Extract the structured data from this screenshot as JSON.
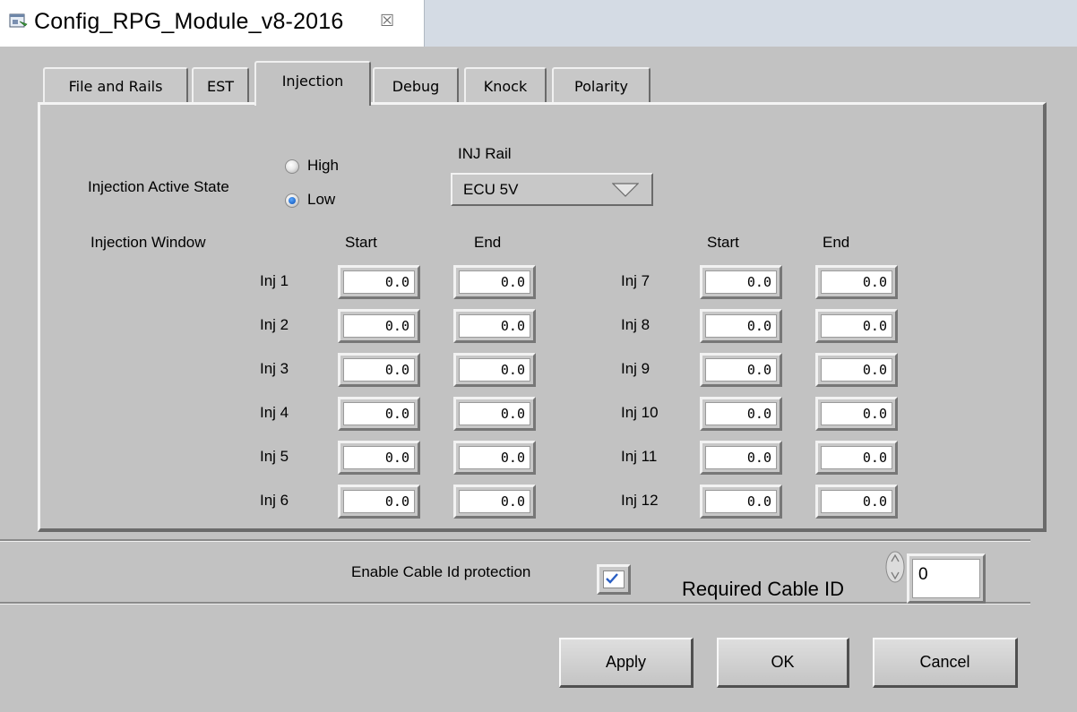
{
  "window": {
    "title": "Config_RPG_Module_v8-2016",
    "close_glyph": "☒",
    "icon": "vi-document-icon"
  },
  "tabs": [
    {
      "label": "File and Rails",
      "active": false
    },
    {
      "label": "EST",
      "active": false
    },
    {
      "label": "Injection",
      "active": true
    },
    {
      "label": "Debug",
      "active": false
    },
    {
      "label": "Knock",
      "active": false
    },
    {
      "label": "Polarity",
      "active": false
    }
  ],
  "injection": {
    "active_state_label": "Injection  Active State",
    "options": [
      {
        "label": "High",
        "selected": false
      },
      {
        "label": "Low",
        "selected": true
      }
    ],
    "rail_label": "INJ Rail",
    "rail_value": "ECU 5V",
    "window_label": "Injection Window",
    "headers": {
      "start": "Start",
      "end": "End"
    },
    "injectors_left": [
      {
        "label": "Inj 1",
        "start": "0.0",
        "end": "0.0"
      },
      {
        "label": "Inj 2",
        "start": "0.0",
        "end": "0.0"
      },
      {
        "label": "Inj 3",
        "start": "0.0",
        "end": "0.0"
      },
      {
        "label": "Inj 4",
        "start": "0.0",
        "end": "0.0"
      },
      {
        "label": "Inj 5",
        "start": "0.0",
        "end": "0.0"
      },
      {
        "label": "Inj 6",
        "start": "0.0",
        "end": "0.0"
      }
    ],
    "injectors_right": [
      {
        "label": "Inj 7",
        "start": "0.0",
        "end": "0.0"
      },
      {
        "label": "Inj 8",
        "start": "0.0",
        "end": "0.0"
      },
      {
        "label": "Inj 9",
        "start": "0.0",
        "end": "0.0"
      },
      {
        "label": "Inj 10",
        "start": "0.0",
        "end": "0.0"
      },
      {
        "label": "Inj 11",
        "start": "0.0",
        "end": "0.0"
      },
      {
        "label": "Inj 12",
        "start": "0.0",
        "end": "0.0"
      }
    ]
  },
  "cable": {
    "protection_label": "Enable Cable Id protection",
    "protection_checked": true,
    "required_label": "Required Cable ID",
    "required_value": "0"
  },
  "buttons": {
    "apply": "Apply",
    "ok": "OK",
    "cancel": "Cancel"
  },
  "colors": {
    "checkbox_check": "#2a5fc4",
    "radio_selected": "#0a4fb3"
  }
}
